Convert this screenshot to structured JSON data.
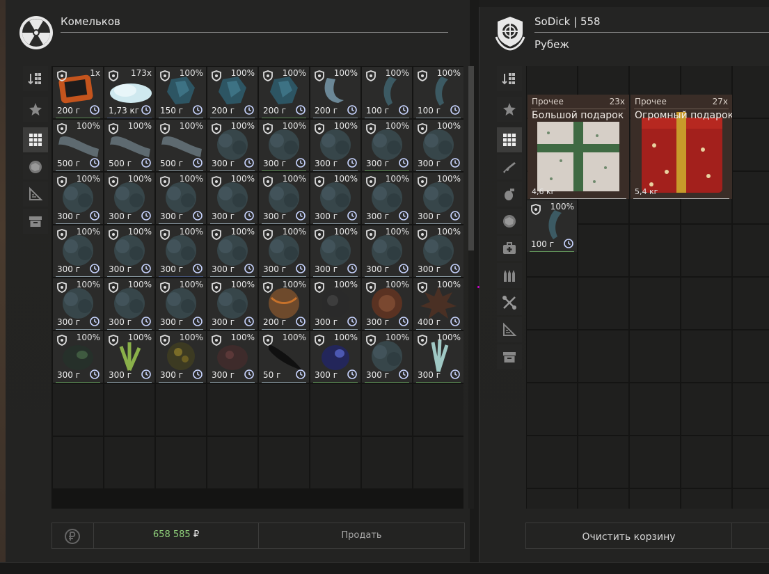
{
  "left_panel": {
    "title": "Комельков",
    "tabs": [
      {
        "icon": "sort-icon",
        "active": false
      },
      {
        "icon": "star-icon",
        "active": false
      },
      {
        "icon": "grid-icon",
        "active": true
      },
      {
        "icon": "ore-icon",
        "active": false
      },
      {
        "icon": "ruler-triangle-icon",
        "active": false
      },
      {
        "icon": "box-icon",
        "active": false
      }
    ],
    "items": [
      {
        "top": "1x",
        "weight": "200 г",
        "art": "device",
        "line": "green"
      },
      {
        "top": "173x",
        "weight": "1,73 кг",
        "art": "snow",
        "line": "blue"
      },
      {
        "top": "100%",
        "weight": "150 г",
        "art": "crystal",
        "line": "grey"
      },
      {
        "top": "100%",
        "weight": "200 г",
        "art": "crystal",
        "line": "grey"
      },
      {
        "top": "100%",
        "weight": "200 г",
        "art": "crystal",
        "line": "green"
      },
      {
        "top": "100%",
        "weight": "200 г",
        "art": "hook",
        "line": "grey"
      },
      {
        "top": "100%",
        "weight": "100 г",
        "art": "claw",
        "line": "grey"
      },
      {
        "top": "100%",
        "weight": "100 г",
        "art": "claw",
        "line": "grey"
      },
      {
        "top": "100%",
        "weight": "500 г",
        "art": "log",
        "line": "grey"
      },
      {
        "top": "100%",
        "weight": "500 г",
        "art": "log",
        "line": "grey"
      },
      {
        "top": "100%",
        "weight": "500 г",
        "art": "log",
        "line": "grey"
      },
      {
        "top": "100%",
        "weight": "300 г",
        "art": "bush",
        "line": "grey"
      },
      {
        "top": "100%",
        "weight": "300 г",
        "art": "bush",
        "line": "green"
      },
      {
        "top": "100%",
        "weight": "300 г",
        "art": "bush",
        "line": "grey"
      },
      {
        "top": "100%",
        "weight": "300 г",
        "art": "bush",
        "line": "green"
      },
      {
        "top": "100%",
        "weight": "300 г",
        "art": "bush",
        "line": "grey"
      },
      {
        "top": "100%",
        "weight": "300 г",
        "art": "bush",
        "line": "grey"
      },
      {
        "top": "100%",
        "weight": "300 г",
        "art": "bush",
        "line": "grey"
      },
      {
        "top": "100%",
        "weight": "300 г",
        "art": "bush",
        "line": "grey"
      },
      {
        "top": "100%",
        "weight": "300 г",
        "art": "bush",
        "line": "grey"
      },
      {
        "top": "100%",
        "weight": "300 г",
        "art": "bush",
        "line": "grey"
      },
      {
        "top": "100%",
        "weight": "300 г",
        "art": "bush",
        "line": "grey"
      },
      {
        "top": "100%",
        "weight": "300 г",
        "art": "bush",
        "line": "grey"
      },
      {
        "top": "100%",
        "weight": "300 г",
        "art": "bush",
        "line": "grey"
      },
      {
        "top": "100%",
        "weight": "300 г",
        "art": "bush",
        "line": "grey"
      },
      {
        "top": "100%",
        "weight": "300 г",
        "art": "bush",
        "line": "grey"
      },
      {
        "top": "100%",
        "weight": "300 г",
        "art": "bush",
        "line": "blue"
      },
      {
        "top": "100%",
        "weight": "300 г",
        "art": "bush",
        "line": "grey"
      },
      {
        "top": "100%",
        "weight": "300 г",
        "art": "bush",
        "line": "grey"
      },
      {
        "top": "100%",
        "weight": "300 г",
        "art": "bush",
        "line": "grey"
      },
      {
        "top": "100%",
        "weight": "300 г",
        "art": "bush",
        "line": "grey"
      },
      {
        "top": "100%",
        "weight": "300 г",
        "art": "bush",
        "line": "grey"
      },
      {
        "top": "100%",
        "weight": "300 г",
        "art": "bush",
        "line": "grey"
      },
      {
        "top": "100%",
        "weight": "300 г",
        "art": "bush",
        "line": "grey"
      },
      {
        "top": "100%",
        "weight": "300 г",
        "art": "bush",
        "line": "grey"
      },
      {
        "top": "100%",
        "weight": "300 г",
        "art": "bush",
        "line": "grey"
      },
      {
        "top": "100%",
        "weight": "200 г",
        "art": "orange",
        "line": "grey"
      },
      {
        "top": "100%",
        "weight": "300 г",
        "art": "dark",
        "line": "grey"
      },
      {
        "top": "100%",
        "weight": "300 г",
        "art": "rust",
        "line": "grey"
      },
      {
        "top": "100%",
        "weight": "400 г",
        "art": "spiky",
        "line": "grey"
      },
      {
        "top": "100%",
        "weight": "300 г",
        "art": "greenstone",
        "line": "green"
      },
      {
        "top": "100%",
        "weight": "300 г",
        "art": "leaf",
        "line": "grey"
      },
      {
        "top": "100%",
        "weight": "300 г",
        "art": "gold",
        "line": "grey"
      },
      {
        "top": "100%",
        "weight": "300 г",
        "art": "redrock",
        "line": "grey"
      },
      {
        "top": "100%",
        "weight": "50 г",
        "art": "feather",
        "line": "grey"
      },
      {
        "top": "100%",
        "weight": "300 г",
        "art": "bluestone",
        "line": "green"
      },
      {
        "top": "100%",
        "weight": "300 г",
        "art": "bush",
        "line": "green"
      },
      {
        "top": "100%",
        "weight": "300 г",
        "art": "shard",
        "line": "green"
      }
    ],
    "money": "658 585",
    "currency": "₽",
    "sell_label": "Продать"
  },
  "right_panel": {
    "title": "SoDick | 558",
    "subtitle": "Рубеж",
    "tabs": [
      {
        "icon": "sort-icon",
        "active": false
      },
      {
        "icon": "star-icon",
        "active": false
      },
      {
        "icon": "grid-icon",
        "active": true
      },
      {
        "icon": "rifle-icon",
        "active": false
      },
      {
        "icon": "grenade-icon",
        "active": false
      },
      {
        "icon": "ore-icon",
        "active": false
      },
      {
        "icon": "medkit-icon",
        "active": false
      },
      {
        "icon": "ammo-icon",
        "active": false
      },
      {
        "icon": "tools-icon",
        "active": false
      },
      {
        "icon": "ruler-triangle-icon",
        "active": false
      },
      {
        "icon": "box-icon",
        "active": false
      }
    ],
    "big_items": [
      {
        "category": "Прочее",
        "count": "23x",
        "name": "Большой подарок",
        "weight": "4,6 кг",
        "art": "gift-white"
      },
      {
        "category": "Прочее",
        "count": "27x",
        "name": "Огромный подарок",
        "weight": "5,4 кг",
        "art": "gift-red"
      }
    ],
    "small_item": {
      "top": "100%",
      "weight": "100 г",
      "art": "claw",
      "line": "green"
    },
    "clear_label": "Очистить корзину"
  }
}
